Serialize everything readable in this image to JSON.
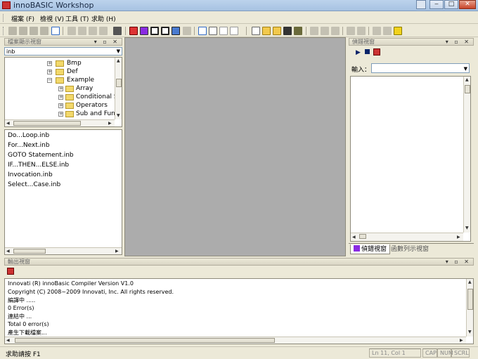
{
  "window": {
    "title": "innoBASIC Workshop",
    "close_glyph": "✕",
    "min_glyph": "‒",
    "max_glyph": "□"
  },
  "menu": [
    {
      "label": "檔案 (F)"
    },
    {
      "label": "檢視 (V)"
    },
    {
      "label": "工具 (T)"
    },
    {
      "label": "求助 (H)"
    }
  ],
  "explorer": {
    "title": "檔案顯示視窗",
    "filter_value": "inb",
    "tree": [
      {
        "label": "Bmp"
      },
      {
        "label": "Def"
      },
      {
        "label": "Example"
      },
      {
        "label": "Array"
      },
      {
        "label": "Conditional S"
      },
      {
        "label": "Operators"
      },
      {
        "label": "Sub and Func"
      }
    ],
    "files": [
      "Do...Loop.inb",
      "For...Next.inb",
      "GOTO Statement.inb",
      "IF...THEN...ELSE.inb",
      "Invocation.inb",
      "Select...Case.inb"
    ]
  },
  "debug": {
    "title": "偵錯視窗",
    "input_label": "輸入：",
    "tabs": [
      {
        "label": "偵錯視窗"
      },
      {
        "label": "函數列示視窗"
      }
    ]
  },
  "output": {
    "title": "輸出視窗",
    "lines": [
      "Innovati (R) innoBasic Compiler Version V1.0",
      "Copyright (C) 2008~2009 Innovati, Inc. All rights reserved.",
      "編譯中 .....",
      "0 Error(s)",
      "連結中 ...",
      "Total 0 error(s)",
      "產生下載檔案..."
    ]
  },
  "status": {
    "help": "求助請按 F1",
    "position": "Ln 11, Col 1",
    "cap": "CAP",
    "num": "NUM",
    "scrl": "SCRL"
  },
  "colors": {
    "accent": "#0a246a",
    "folder": "#f2d86b",
    "close": "#c9452a"
  }
}
